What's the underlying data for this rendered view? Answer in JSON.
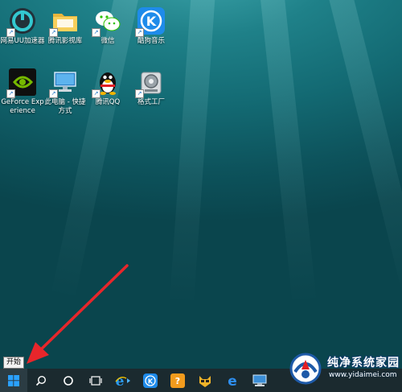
{
  "desktop_icons": [
    {
      "label": "网易UU加速器"
    },
    {
      "label": "腾讯影视库"
    },
    {
      "label": "微信"
    },
    {
      "label": "酷狗音乐"
    },
    {
      "label": "GeForce Experience"
    },
    {
      "label": "此电脑 - 快捷方式"
    },
    {
      "label": "腾讯QQ"
    },
    {
      "label": "格式工厂"
    }
  ],
  "tooltip": {
    "text": "开始"
  },
  "taskbar": {
    "items": [
      {
        "icon": "windows-start-icon"
      },
      {
        "icon": "search-icon"
      },
      {
        "icon": "cortana-circle-icon"
      },
      {
        "icon": "task-view-icon"
      },
      {
        "icon": "internet-explorer-icon"
      },
      {
        "icon": "kugou-icon"
      },
      {
        "icon": "tencent-app-icon"
      },
      {
        "icon": "cat-app-icon"
      },
      {
        "icon": "edge-icon"
      },
      {
        "icon": "computer-icon"
      }
    ]
  },
  "watermark": {
    "title": "纯净系统家园",
    "url": "www.yidaimei.com"
  },
  "colors": {
    "desktop_bg": "#136a73",
    "taskbar_bg": "#1b2a2f",
    "arrow": "#e8262b",
    "windows_blue": "#1e90ff"
  }
}
